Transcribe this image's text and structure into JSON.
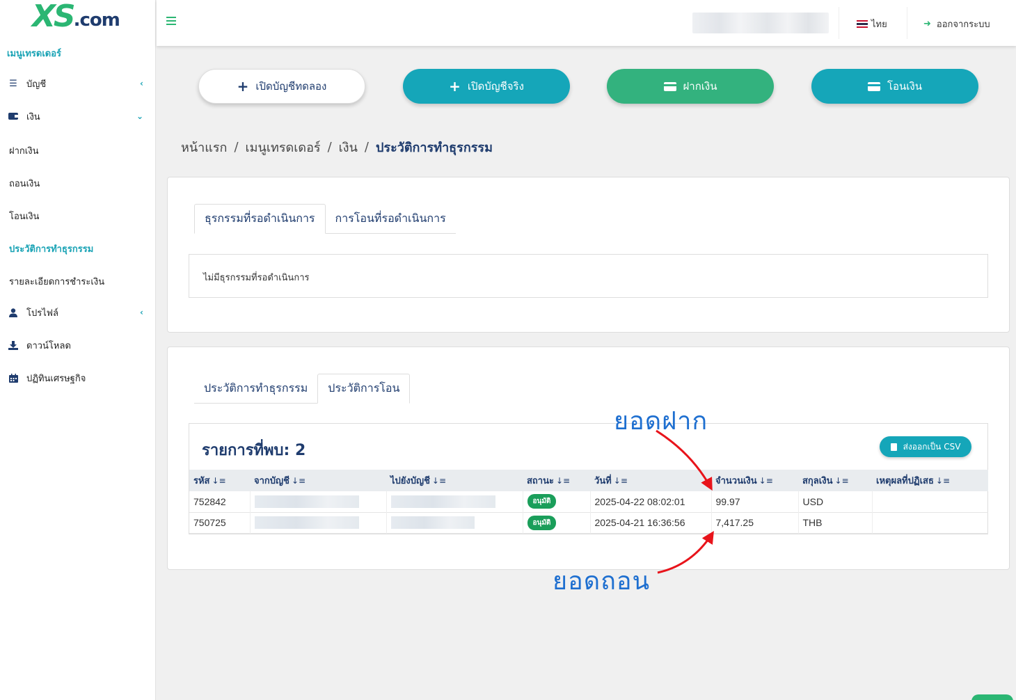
{
  "brand": {
    "logo_xs": "XS",
    "logo_domain": ".com"
  },
  "sidebar": {
    "menu_title": "เมนูเทรดเดอร์",
    "items": [
      {
        "label": "บัญชี",
        "icon": "list-icon"
      },
      {
        "label": "เงิน",
        "icon": "wallet-icon"
      },
      {
        "label": "ฝากเงิน"
      },
      {
        "label": "ถอนเงิน"
      },
      {
        "label": "โอนเงิน"
      },
      {
        "label": "ประวัติการทำธุรกรรม"
      },
      {
        "label": "รายละเอียดการชำระเงิน"
      },
      {
        "label": "โปรไฟล์",
        "icon": "user-icon"
      },
      {
        "label": "ดาวน์โหลด",
        "icon": "download-icon"
      },
      {
        "label": "ปฏิทินเศรษฐกิจ",
        "icon": "calendar-icon"
      }
    ]
  },
  "topbar": {
    "language": "ไทย",
    "logout": "ออกจากระบบ"
  },
  "actions": {
    "demo": "เปิดบัญชีทดลอง",
    "real": "เปิดบัญชีจริง",
    "deposit": "ฝากเงิน",
    "transfer": "โอนเงิน"
  },
  "breadcrumb": {
    "home": "หน้าแรก",
    "trader_menu": "เมนูเทรดเดอร์",
    "money": "เงิน",
    "current": "ประวัติการทำธุรกรรม",
    "separator": "/"
  },
  "pending": {
    "tabs": [
      "ธุรกรรมที่รอดำเนินการ",
      "การโอนที่รอดำเนินการ"
    ],
    "empty_message": "ไม่มีธุรกรรมที่รอดำเนินการ"
  },
  "history": {
    "tabs": [
      "ประวัติการทำธุรกรรม",
      "ประวัติการโอน"
    ],
    "found_label": "รายการที่พบ: 2",
    "csv_button": "ส่งออกเป็น CSV",
    "columns": [
      "รหัส",
      "จากบัญชี",
      "ไปยังบัญชี",
      "สถานะ",
      "วันที่",
      "จำนวนเงิน",
      "สกุลเงิน",
      "เหตุผลที่ปฏิเสธ"
    ],
    "rows": [
      {
        "id": "752842",
        "status": "อนุมัติ",
        "date": "2025-04-22 08:02:01",
        "amount": "99.97",
        "currency": "USD",
        "reason": ""
      },
      {
        "id": "750725",
        "status": "อนุมัติ",
        "date": "2025-04-21 16:36:56",
        "amount": "7,417.25",
        "currency": "THB",
        "reason": ""
      }
    ]
  },
  "annotations": {
    "deposit_label": "ยอดฝาก",
    "withdraw_label": "ยอดถอน"
  },
  "colors": {
    "teal": "#15a6b9",
    "green": "#33b27e",
    "navy": "#1f3c6e",
    "annotation": "#1e6fd0",
    "arrow": "#e8141b"
  }
}
